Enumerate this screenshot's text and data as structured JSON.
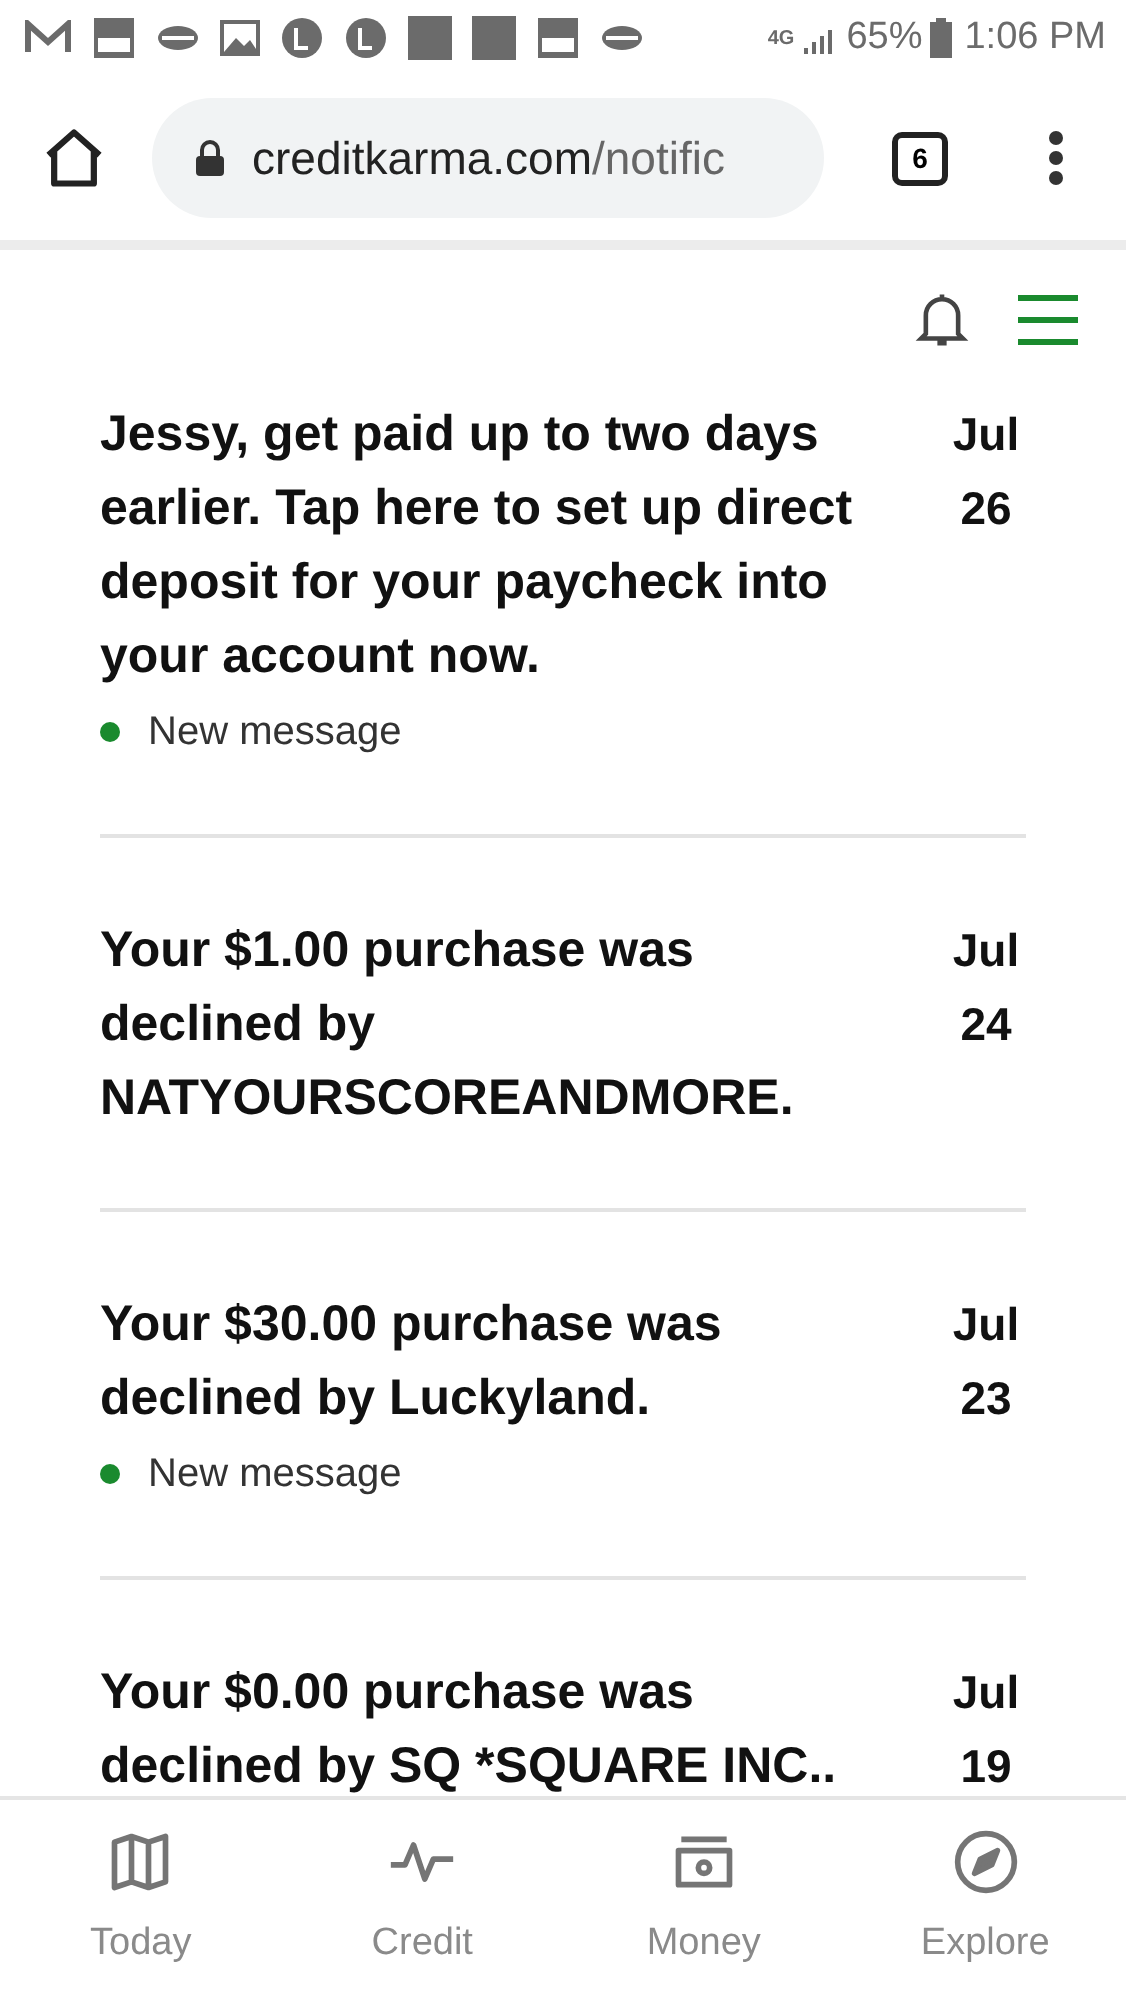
{
  "status_bar": {
    "network": "4G",
    "battery": "65%",
    "time": "1:06 PM"
  },
  "browser": {
    "url_host": "creditkarma.com",
    "url_path": "/notific",
    "tab_count": "6"
  },
  "notifications": [
    {
      "text": "Jessy, get paid up to two days earlier. Tap here to set up direct deposit for your paycheck into your account now.",
      "month": "Jul",
      "day": "26",
      "new": true,
      "badge": "New message"
    },
    {
      "text": "Your $1.00 purchase was declined by NATYOURSCOREANDMORE.",
      "month": "Jul",
      "day": "24",
      "new": false
    },
    {
      "text": "Your $30.00 purchase was declined by Luckyland.",
      "month": "Jul",
      "day": "23",
      "new": true,
      "badge": "New message"
    },
    {
      "text": "Your $0.00 purchase was declined by SQ *SQUARE INC..",
      "month": "Jul",
      "day": "19",
      "new": false
    }
  ],
  "bottom_nav": [
    {
      "kind": "map",
      "label": "Today"
    },
    {
      "kind": "pulse",
      "label": "Credit"
    },
    {
      "kind": "cash",
      "label": "Money"
    },
    {
      "kind": "compass",
      "label": "Explore"
    }
  ]
}
